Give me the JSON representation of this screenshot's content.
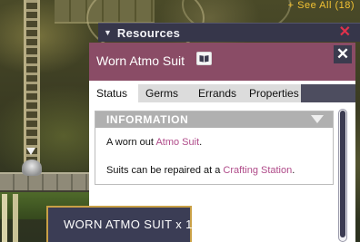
{
  "top_link": {
    "label": "+ See All (18)"
  },
  "resources_panel": {
    "caret_icon": "triangle-down",
    "title": "Resources",
    "close_icon": "x"
  },
  "details": {
    "name": "Worn Atmo Suit",
    "codex_icon": "book",
    "close_icon": "x",
    "tabs": [
      {
        "label": "Status",
        "active": true
      },
      {
        "label": "Germs",
        "active": false
      },
      {
        "label": "Errands",
        "active": false
      },
      {
        "label": "Properties",
        "active": false
      }
    ],
    "information": {
      "header": "INFORMATION",
      "line1_prefix": "A worn out ",
      "line1_link": "Atmo Suit",
      "line1_suffix": ".",
      "line2_prefix": "Suits can be repaired at a ",
      "line2_link": "Crafting Station",
      "line2_suffix": "."
    }
  },
  "tooltip": {
    "text": "WORN ATMO SUIT x 1"
  },
  "colors": {
    "header_accent": "#8a4c66",
    "link": "#b04c8a",
    "resource_close": "#e0314b",
    "see_all": "#f2c233",
    "tooltip_border": "#c9a046"
  }
}
